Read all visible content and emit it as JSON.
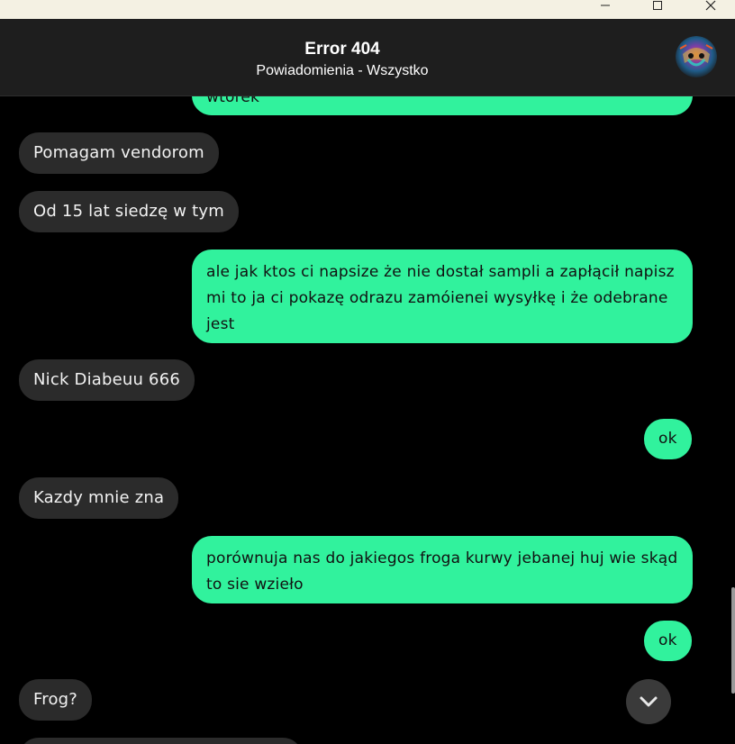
{
  "window": {
    "controls": [
      "minimize-icon",
      "maximize-icon",
      "close-icon"
    ]
  },
  "header": {
    "title": "Error 404",
    "subtitle": "Powiadomienia - Wszystko",
    "avatar_icon": "avatar-image"
  },
  "colors": {
    "incoming_bubble": "#2b2b2b",
    "outgoing_bubble": "#31f29d",
    "background": "#000000",
    "header": "#1e1e1e"
  },
  "messages": [
    {
      "dir": "out",
      "text": "wtorek"
    },
    {
      "dir": "in",
      "text": "Pomagam vendorom"
    },
    {
      "dir": "in",
      "text": "Od 15 lat siedzę w tym"
    },
    {
      "dir": "out",
      "text": "ale jak ktos ci napsize że nie dostał sampli a zapłącił napisz mi to ja ci pokazę odrazu zamóienei wysyłkę i że odebrane jest"
    },
    {
      "dir": "in",
      "text": "Nick Diabeuu 666"
    },
    {
      "dir": "out",
      "text": "ok"
    },
    {
      "dir": "in",
      "text": "Kazdy mnie zna"
    },
    {
      "dir": "out",
      "text": "porównuja nas do jakiegos froga kurwy jebanej huj wie skąd to sie wzieło"
    },
    {
      "dir": "out",
      "text": "ok"
    },
    {
      "dir": "in",
      "text": "Frog?"
    },
    {
      "dir": "in",
      "text": ""
    }
  ],
  "scroll_button_icon": "chevron-down-icon"
}
